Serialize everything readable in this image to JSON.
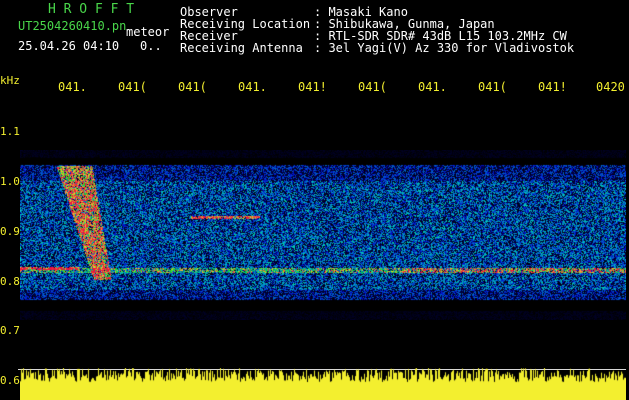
{
  "header": {
    "brand": "H R O F F T",
    "filename": "UT2504260410.pn",
    "mode": "meteor",
    "date_time": "25.04.26 04:10",
    "count": "0..",
    "fields": [
      {
        "label": "Observer",
        "value": ": Masaki Kano"
      },
      {
        "label": "Receiving Location",
        "value": ": Shibukawa, Gunma, Japan"
      },
      {
        "label": "Receiver",
        "value": ": RTL-SDR SDR# 43dB L15 103.2MHz CW"
      },
      {
        "label": "Receiving Antenna",
        "value": ": 3el Yagi(V) Az 330 for Vladivostok"
      }
    ]
  },
  "axis": {
    "unit": "kHz",
    "y_ticks": [
      "1.1",
      "1.0",
      "0.9",
      "0.8",
      "0.7",
      "0.6"
    ],
    "x_ticks": [
      "041.",
      "041(",
      "041(",
      "041.",
      "041!",
      "041(",
      "041.",
      "041(",
      "041!",
      "0420"
    ]
  },
  "colors": {
    "background": "#000000",
    "header_green": "#49d64a",
    "header_white": "#ffffff",
    "axis_yellow": "#f3ef2f"
  }
}
